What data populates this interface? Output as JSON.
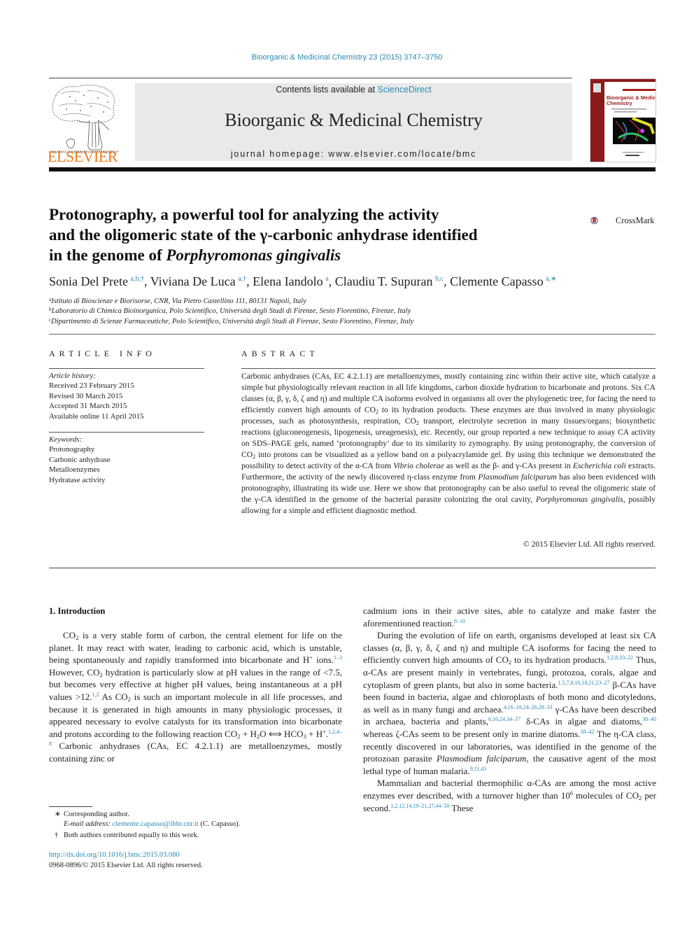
{
  "header": {
    "citation": "Bioorganic & Medicinal Chemistry 23 (2015) 3747–3750",
    "contents_prefix": "Contents lists available at ",
    "contents_link": "ScienceDirect",
    "journal_title": "Bioorganic & Medicinal Chemistry",
    "homepage_prefix": "journal homepage: ",
    "homepage_url": "www.elsevier.com/locate/bmc",
    "publisher_logo_text": "ELSEVIER",
    "cover_title": "Bioorganic & Medicinal Chemistry",
    "brand_color": "#f07a1a",
    "link_color": "#2a8ab3"
  },
  "article": {
    "title_line1": "Protonography, a powerful tool for analyzing the activity",
    "title_line2": "and the oligomeric state of the γ-carbonic anhydrase identified",
    "title_line3_prefix": "in the genome of ",
    "title_line3_italic": "Porphyromonas gingivalis",
    "crossmark_label": "CrossMark",
    "authors": [
      {
        "name": "Sonia Del Prete",
        "marks": "a,b,†"
      },
      {
        "name": "Viviana De Luca",
        "marks": "a,†"
      },
      {
        "name": "Elena Iandolo",
        "marks": "a"
      },
      {
        "name": "Claudiu T. Supuran",
        "marks": "b,c"
      },
      {
        "name": "Clemente Capasso",
        "marks": "a,∗"
      }
    ],
    "affiliations": [
      {
        "mark": "a",
        "text": "Istituto di Bioscienze e Biorisorse, CNR, Via Pietro Castellino 111, 80131 Napoli, Italy"
      },
      {
        "mark": "b",
        "text": "Laboratorio di Chimica Bioinorganica, Polo Scientifico, Università degli Studi di Firenze, Sesto Fiorentino, Firenze, Italy"
      },
      {
        "mark": "c",
        "text": "Dipartimento di Scienze Farmaceutiche, Polo Scientifico, Università degli Studi di Firenze, Sesto Fiorentino, Firenze, Italy"
      }
    ]
  },
  "article_info": {
    "heading": "ARTICLE INFO",
    "history_label": "Article history:",
    "history": [
      "Received 23 February 2015",
      "Revised 30 March 2015",
      "Accepted 31 March 2015",
      "Available online 11 April 2015"
    ],
    "keywords_label": "Keywords:",
    "keywords": [
      "Protonography",
      "Carbonic anhydrase",
      "Metalloenzymes",
      "Hydratase activity"
    ]
  },
  "abstract": {
    "heading": "ABSTRACT",
    "segments": [
      "Carbonic anhydrases (CAs, EC 4.2.1.1) are metalloenzymes, mostly containing zinc within their active site, which catalyze a simple but physiologically relevant reaction in all life kingdoms, carbon dioxide hydration to bicarbonate and protons. Six CA classes (α, β, γ, δ, ζ and η) and multiple CA isoforms evolved in organisms all over the phylogenetic tree, for facing the need to efficiently convert high amounts of CO",
      "2",
      " to its hydration products. These enzymes are thus involved in many physiologic processes, such as photosynthesis, respiration, CO",
      "2",
      " transport, electrolyte secretion in many tissues/organs; biosynthetic reactions (gluconeogenesis, lipogenesis, ureagenesis), etc. Recently, our group reported a new technique to assay CA activity on SDS–PAGE gels, named ‘protonography’ due to its similarity to zymography. By using protonography, the conversion of CO",
      "2",
      " into protons can be visualized as a yellow band on a polyacrylamide gel. By using this technique we demonstrated the possibility to detect activity of the α-CA from ",
      "Vibrio cholerae",
      " as well as the β- and γ-CAs present in ",
      "Escherichia coli",
      " extracts. Furthermore, the activity of the newly discovered η-class enzyme from ",
      "Plasmodium falciparum",
      " has also been evidenced with protonography, illustrating its wide use. Here we show that protonography can be also useful to reveal the oligomeric state of the γ-CA identified in the genome of the bacterial parasite colonizing the oral cavity, ",
      "Porphyromonas gingivalis",
      ", possibly allowing for a simple and efficient diagnostic method."
    ],
    "copyright": "© 2015 Elsevier Ltd. All rights reserved."
  },
  "intro": {
    "heading": "1. Introduction",
    "left": {
      "p1_a": "CO",
      "p1_b": "2",
      "p1_c": " is a very stable form of carbon, the central element for life on the planet. It may react with water, leading to carbonic acid, which is unstable, being spontaneously and rapidly transformed into bicarbonate and H",
      "p1_d": "+",
      "p1_e": " ions.",
      "ref1": "1–3",
      "p1_f": " However, CO",
      "p1_g": "2",
      "p1_h": " hydration is particularly slow at pH values in the range of <7.5, but becomes very effective at higher pH values, being instantaneous at a pH values >12.",
      "ref2": "1,2",
      "p1_i": " As CO",
      "p1_j": "2",
      "p1_k": " is such an important molecule in all life processes, and because it is generated in high amounts in many physiologic processes, it appeared necessary to evolve catalysts for its transformation into bicarbonate and protons according to the following reaction  CO",
      "p1_l": "2",
      "p1_m": " + H",
      "p1_n": "2",
      "p1_o": "O ⟺ HCO",
      "p1_p": "3",
      "p1_q": " + H",
      "p1_r": "+",
      "p1_s": ".",
      "ref3": "1,2,4–8",
      "p1_t": "  Carbonic anhydrases (CAs, EC 4.2.1.1) are metalloenzymes, mostly containing zinc or"
    },
    "right": {
      "p1_a": "cadmium ions in their active sites, able to catalyze and make faster the aforementioned reaction.",
      "ref4": "8–10",
      "p2_a": "During the evolution of life on earth, organisms developed at least six CA classes (α, β, γ, δ, ζ and η) and multiple CA isoforms for facing the need to efficiently convert high amounts of CO",
      "p2_b": "2",
      "p2_c": " to its hydration products.",
      "ref5": "1,2,8,10–22",
      "p2_d": " Thus, α-CAs are present mainly in vertebrates, fungi, protozoa, corals, algae and cytoplasm of green plants, but also in some bacteria.",
      "ref6": "1,5,7,8,16,18,21,23–27",
      "p2_e": " β-CAs have been found in bacteria, algae and chloroplasts of both mono and dicotyledons, as well as in many fungi and archaea.",
      "ref7": "4,16–18,24–26,28–33",
      "p2_f": " γ-CAs have been described in archaea, bacteria and plants,",
      "ref8": "6,16,24,34–37",
      "p2_g": " δ-CAs in algae and diatoms,",
      "ref9": "38–40",
      "p2_h": " whereas ζ-CAs seem to be present only in marine diatoms.",
      "ref10": "38–42",
      "p2_i": " The η-CA class, recently discovered in our laboratories, was identified in the genome of the protozoan parasite ",
      "p2_j": "Plasmodium falciparum",
      "p2_k": ", the causative agent of the most lethal type of human malaria.",
      "ref11": "9,11,43",
      "p3_a": "Mammalian and bacterial thermophilic α-CAs are among the most active enzymes ever described, with a turnover higher than 10",
      "p3_b": "6",
      "p3_c": " molecules of CO",
      "p3_d": "2",
      "p3_e": " per second.",
      "ref12": "1,2,12,14,19–21,27,44–50",
      "p3_f": " These"
    }
  },
  "footnotes": {
    "corresponding_mark": "∗",
    "corresponding": "Corresponding author.",
    "email_label": "E-mail address: ",
    "email": "clemente.capasso@ibbr.cnr.it",
    "email_suffix": " (C. Capasso).",
    "equal_mark": "†",
    "equal": "Both authors contributed equally to this work.",
    "doi": "http://dx.doi.org/10.1016/j.bmc.2015.03.080",
    "issn": "0968-0896/© 2015 Elsevier Ltd. All rights reserved."
  }
}
